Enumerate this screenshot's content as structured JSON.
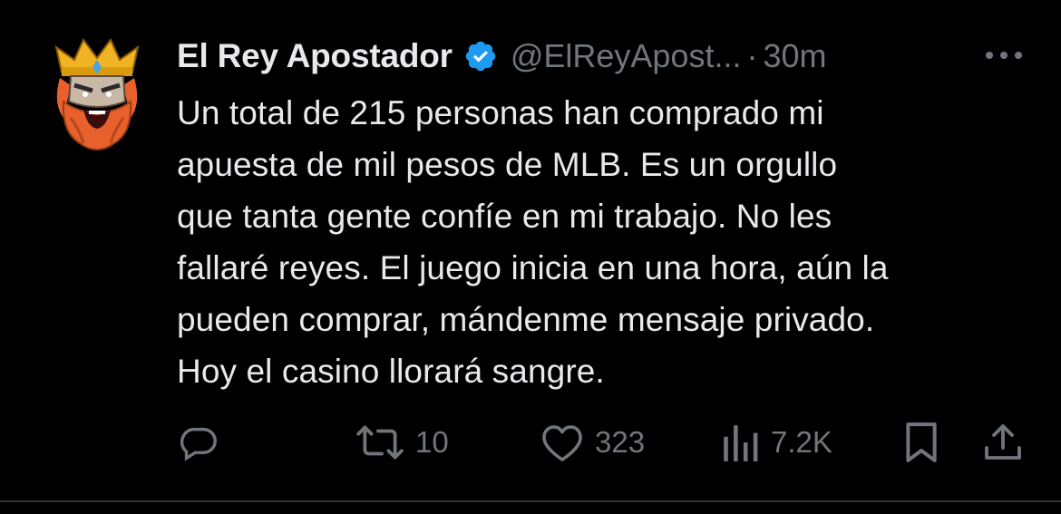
{
  "tweet": {
    "author": {
      "display_name": "El Rey Apostador",
      "handle": "@ElReyApost...",
      "verified": true,
      "avatar_icon": "bearded-king-avatar-icon"
    },
    "separator": "·",
    "timestamp": "30m",
    "body_lines": [
      "Un total de 215 personas han comprado mi",
      "apuesta de mil pesos de MLB. Es un orgullo",
      "que tanta gente confíe en mi trabajo. No les",
      "fallaré reyes. El juego inicia en una hora, aún la",
      "pueden comprar, mándenme mensaje privado.",
      "Hoy el casino llorará sangre."
    ],
    "actions": {
      "reply_count": "",
      "retweet_count": "10",
      "like_count": "323",
      "views_count": "7.2K"
    }
  },
  "colors": {
    "background": "#000000",
    "text_primary": "#e7e9ea",
    "text_secondary": "#71767b",
    "verified_badge": "#1d9bf0",
    "divider": "#2f3336"
  }
}
